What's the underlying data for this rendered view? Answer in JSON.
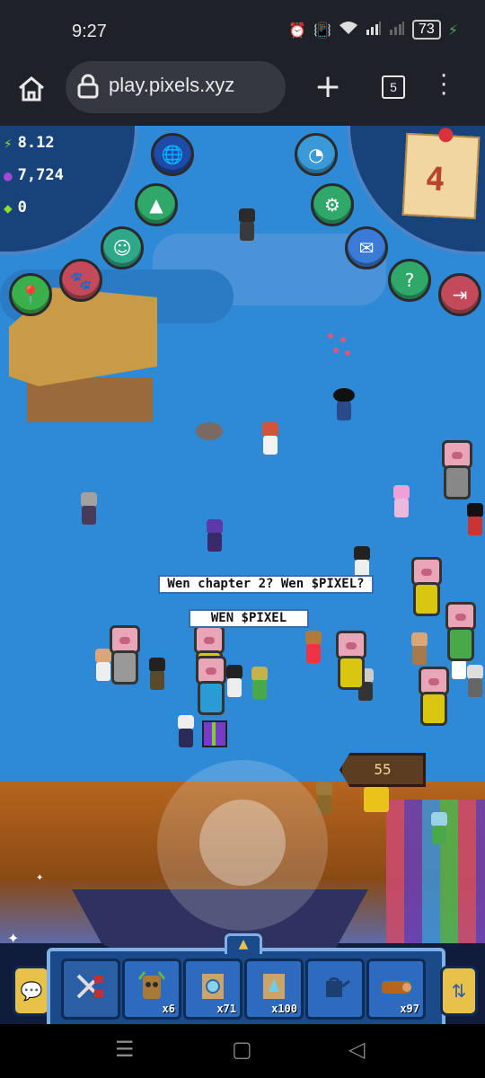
{
  "status_bar": {
    "time": "9:27",
    "battery": "73",
    "icons": [
      "alarm-icon",
      "vibrate-icon",
      "wifi-icon",
      "signal-icon",
      "signal-icon",
      "battery-icon"
    ]
  },
  "browser": {
    "url": "play.pixels.xyz",
    "tab_count": "5"
  },
  "hud": {
    "energy": "8.12",
    "coins": "7,724",
    "gems": "0",
    "quest_count": "4",
    "menu_icons": [
      "globe-icon",
      "star-icon",
      "chat-face-icon",
      "paw-icon",
      "map-pin-icon",
      "speedometer-icon",
      "gear-icon",
      "mail-icon",
      "help-icon",
      "exit-icon"
    ]
  },
  "chat": {
    "bubble_1": "Wen chapter 2? Wen $PIXEL?",
    "bubble_2": "WEN $PIXEL"
  },
  "price_tag": "55",
  "toolbar": {
    "slots": [
      {
        "name": "shears",
        "count": ""
      },
      {
        "name": "tree-sprite",
        "count": "x6"
      },
      {
        "name": "seed-bag-blue",
        "count": "x71"
      },
      {
        "name": "seed-bag-crystal",
        "count": "x100"
      },
      {
        "name": "watering-can",
        "count": ""
      },
      {
        "name": "wood-log",
        "count": "x97"
      }
    ]
  },
  "colors": {
    "water": "#2e8ad6",
    "hud_blue": "#17427a",
    "hud_border": "#4d84c7",
    "toolbar_blue": "#1b4a8a",
    "gem_green": "#8be02a",
    "coin_purple": "#a24ad6"
  }
}
